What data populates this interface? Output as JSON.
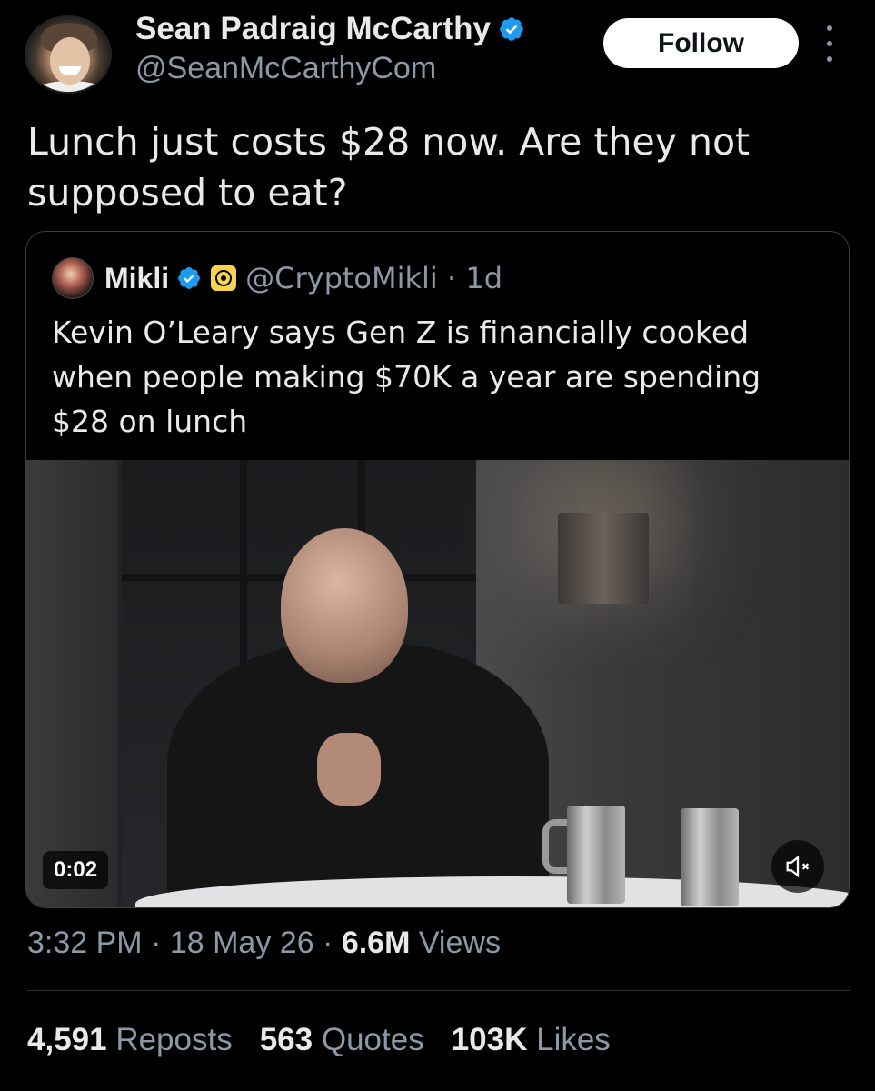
{
  "author": {
    "name": "Sean Padraig McCarthy",
    "handle": "@SeanMcCarthyCom",
    "verified": true
  },
  "follow_label": "Follow",
  "tweet_text": "Lunch just costs $28 now. Are they not supposed to eat?",
  "quoted": {
    "name": "Mikli",
    "handle": "@CryptoMikli",
    "time_sep": " · 1d",
    "text": "Kevin O’Leary says Gen Z is financially cooked when people making $70K a year are spending $28 on lunch",
    "video_time": "0:02"
  },
  "meta": {
    "time": "3:32 PM",
    "sep1": " · ",
    "date": "18 May 26",
    "sep2": " · ",
    "views_count": "6.6M",
    "views_label": " Views"
  },
  "stats": {
    "reposts_count": "4,591",
    "reposts_label": " Reposts",
    "quotes_count": "563",
    "quotes_label": " Quotes",
    "likes_count": "103K",
    "likes_label": " Likes"
  },
  "colors": {
    "background": "#000000",
    "text_primary": "#e7e9ea",
    "text_secondary": "#8b98a5",
    "verified_blue": "#1d9bf0",
    "border": "#3b3f44"
  }
}
